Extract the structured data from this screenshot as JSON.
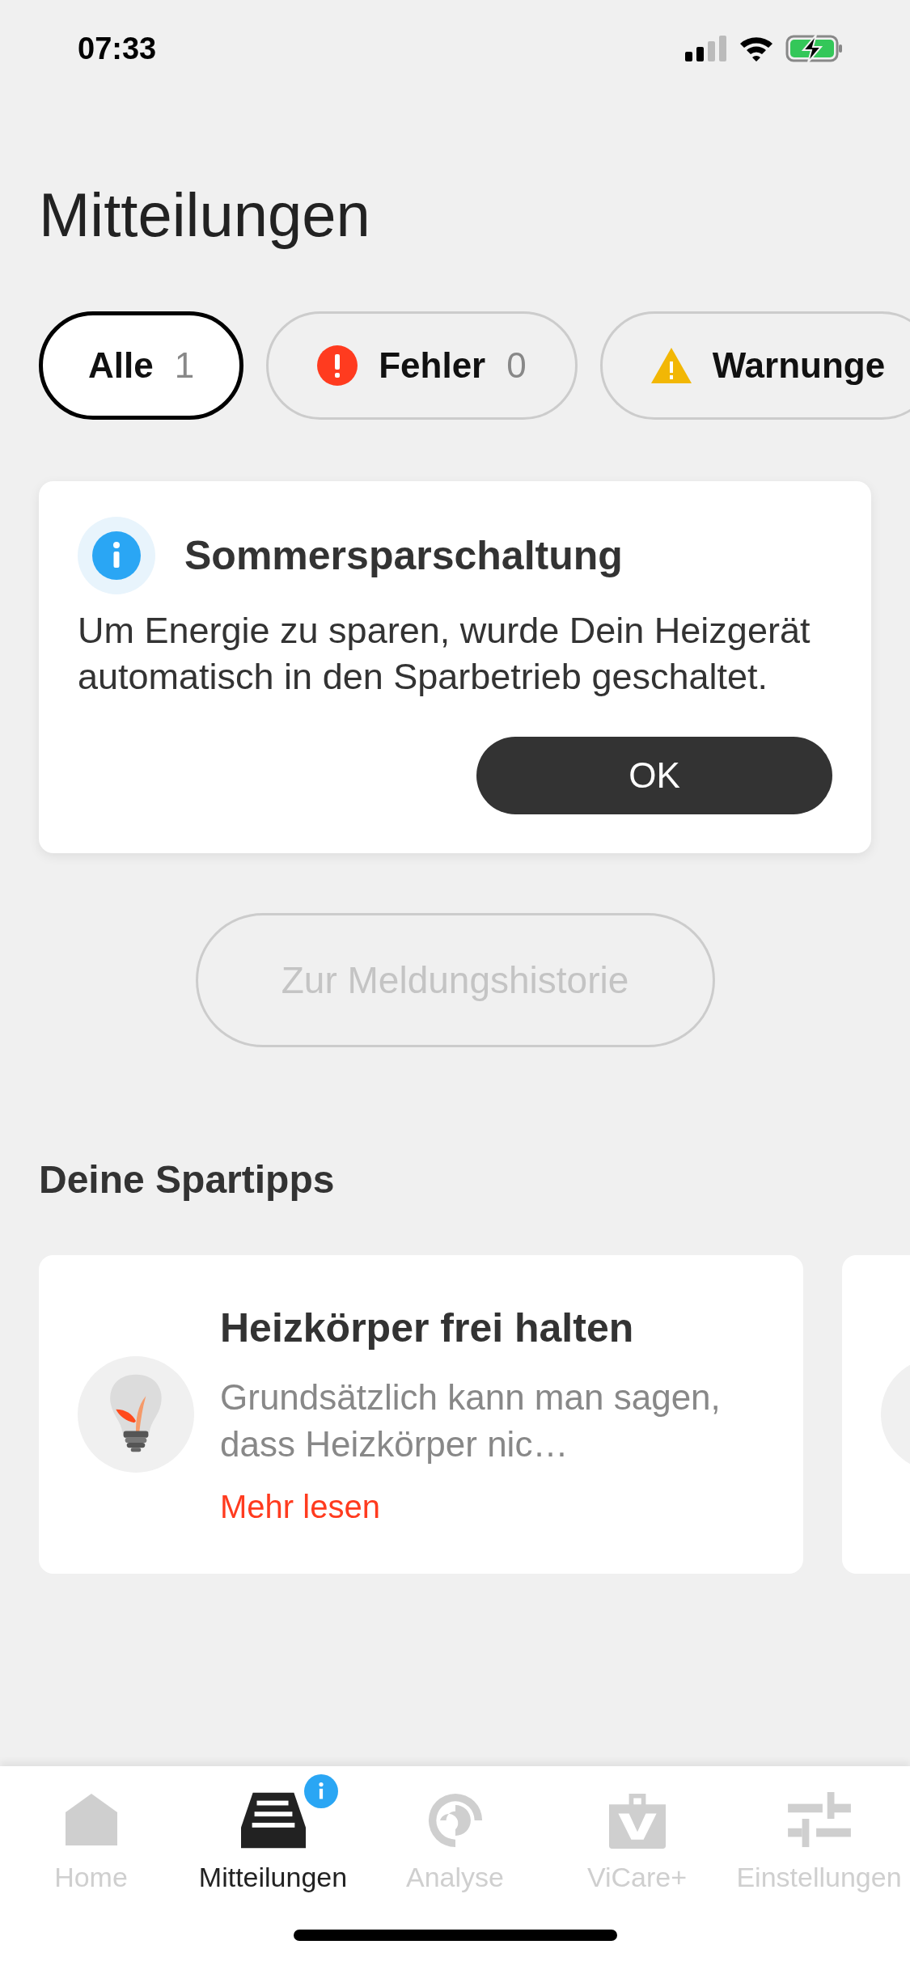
{
  "status_bar": {
    "time": "07:33"
  },
  "title": "Mitteilungen",
  "filters": [
    {
      "kind": "all",
      "label": "Alle",
      "count": "1",
      "selected": true
    },
    {
      "kind": "error",
      "label": "Fehler",
      "count": "0",
      "selected": false
    },
    {
      "kind": "warning",
      "label": "Warnunge",
      "selected": false
    }
  ],
  "notifications": [
    {
      "kind": "info",
      "title": "Sommersparschaltung",
      "body": "Um Energie zu sparen, wurde Dein Heizgerät automatisch in den Sparbetrieb geschaltet.",
      "button": "OK"
    }
  ],
  "history_button": {
    "label": "Zur Meldungshistorie",
    "disabled": true
  },
  "tips_section": {
    "title": "Deine Spartipps",
    "tips": [
      {
        "title": "Heizkörper frei halten",
        "text": "Grundsätzlich kann man sagen, dass Heizkörper nic…",
        "link": "Mehr lesen"
      }
    ]
  },
  "tab_bar": [
    {
      "kind": "home",
      "label": "Home",
      "selected": false,
      "badge": false
    },
    {
      "kind": "inbox",
      "label": "Mitteilungen",
      "selected": true,
      "badge": true
    },
    {
      "kind": "analysis",
      "label": "Analyse",
      "selected": false,
      "badge": false
    },
    {
      "kind": "vicare",
      "label": "ViCare+",
      "selected": false,
      "badge": false
    },
    {
      "kind": "settings",
      "label": "Einstellungen",
      "selected": false,
      "badge": false
    }
  ]
}
